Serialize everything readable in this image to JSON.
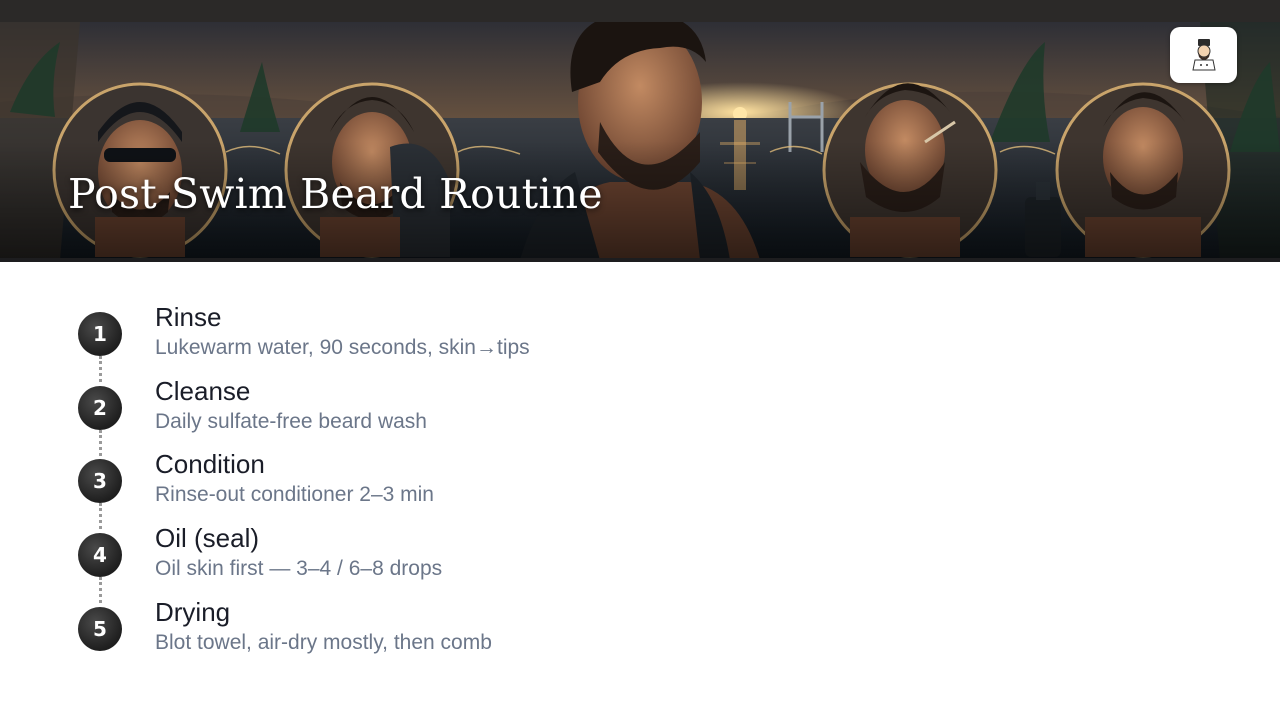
{
  "page": {
    "title": "Post-Swim Beard Routine"
  },
  "banner": {
    "logo_icon": "barber-mascot-logo-icon",
    "colors": {
      "sky_glow": "#e7a45a",
      "sky_dark": "#2a2d35",
      "water": "#1c2a36",
      "ring": "#c9a46b"
    }
  },
  "steps": [
    {
      "number": "1",
      "title": "Rinse",
      "desc": "Lukewarm water, 90 seconds, skin→tips"
    },
    {
      "number": "2",
      "title": "Cleanse",
      "desc": "Daily sulfate-free beard wash"
    },
    {
      "number": "3",
      "title": "Condition",
      "desc": "Rinse-out conditioner 2–3 min"
    },
    {
      "number": "4",
      "title": "Oil (seal)",
      "desc": "Oil skin first — 3–4 / 6–8 drops"
    },
    {
      "number": "5",
      "title": "Drying",
      "desc": "Blot towel, air-dry mostly, then comb"
    }
  ]
}
